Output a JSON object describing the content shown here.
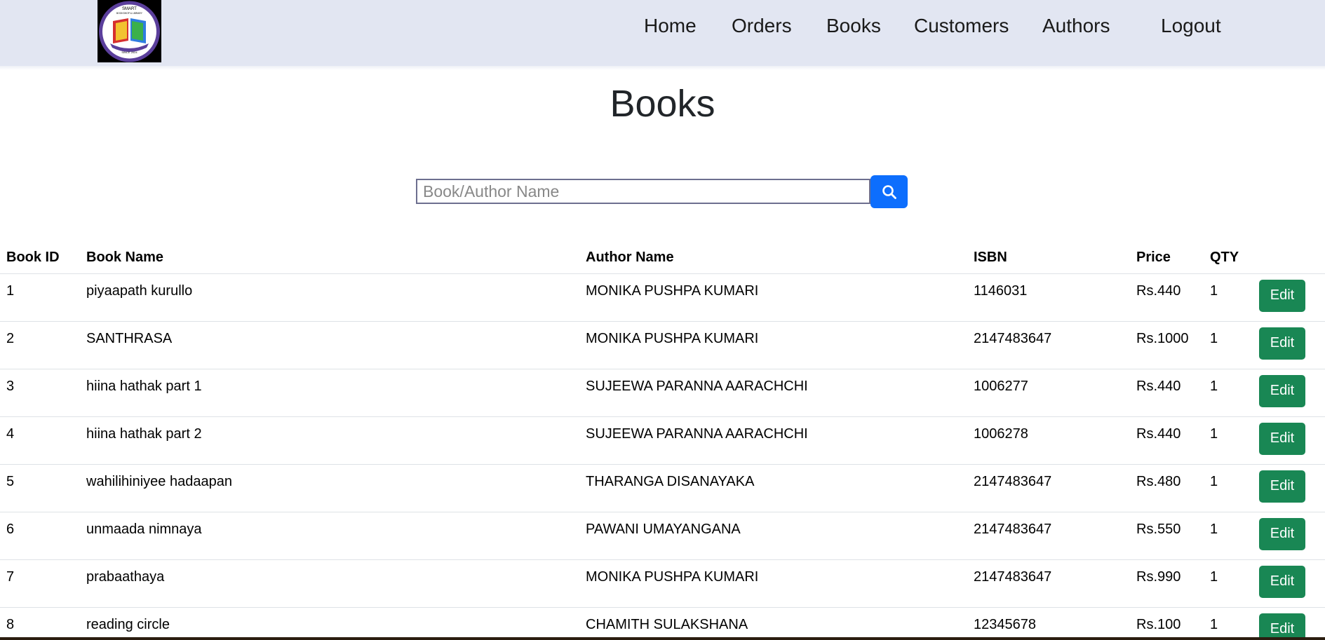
{
  "nav": {
    "logo_text_top": "SMART",
    "logo_text_sub": "BOOKSHOP & LIBRARY",
    "logo_text_bottom": "SINCE 2024",
    "links": [
      "Home",
      "Orders",
      "Books",
      "Customers",
      "Authors",
      "Logout"
    ]
  },
  "page": {
    "title": "Books"
  },
  "search": {
    "placeholder": "Book/Author Name",
    "value": "",
    "button_icon": "search-icon",
    "button_color": "#0d6efd"
  },
  "table": {
    "headers": [
      "Book ID",
      "Book Name",
      "Author Name",
      "ISBN",
      "Price",
      "QTY",
      ""
    ],
    "action_label": "Edit",
    "action_color": "#198754",
    "rows": [
      {
        "id": "1",
        "name": "piyaapath kurullo",
        "author": "MONIKA PUSHPA KUMARI",
        "isbn": "1146031",
        "price": "Rs.440",
        "qty": "1"
      },
      {
        "id": "2",
        "name": "SANTHRASA",
        "author": "MONIKA PUSHPA KUMARI",
        "isbn": "2147483647",
        "price": "Rs.1000",
        "qty": "1"
      },
      {
        "id": "3",
        "name": "hiina hathak part 1",
        "author": "SUJEEWA PARANNA AARACHCHI",
        "isbn": "1006277",
        "price": "Rs.440",
        "qty": "1"
      },
      {
        "id": "4",
        "name": "hiina hathak part 2",
        "author": "SUJEEWA PARANNA AARACHCHI",
        "isbn": "1006278",
        "price": "Rs.440",
        "qty": "1"
      },
      {
        "id": "5",
        "name": "wahilihiniyee hadaapan",
        "author": "THARANGA DISANAYAKA",
        "isbn": "2147483647",
        "price": "Rs.480",
        "qty": "1"
      },
      {
        "id": "6",
        "name": "unmaada nimnaya",
        "author": "PAWANI UMAYANGANA",
        "isbn": "2147483647",
        "price": "Rs.550",
        "qty": "1"
      },
      {
        "id": "7",
        "name": "prabaathaya",
        "author": "MONIKA PUSHPA KUMARI",
        "isbn": "2147483647",
        "price": "Rs.990",
        "qty": "1"
      },
      {
        "id": "8",
        "name": "reading circle",
        "author": "CHAMITH SULAKSHANA",
        "isbn": "12345678",
        "price": "Rs.100",
        "qty": "1"
      }
    ]
  }
}
